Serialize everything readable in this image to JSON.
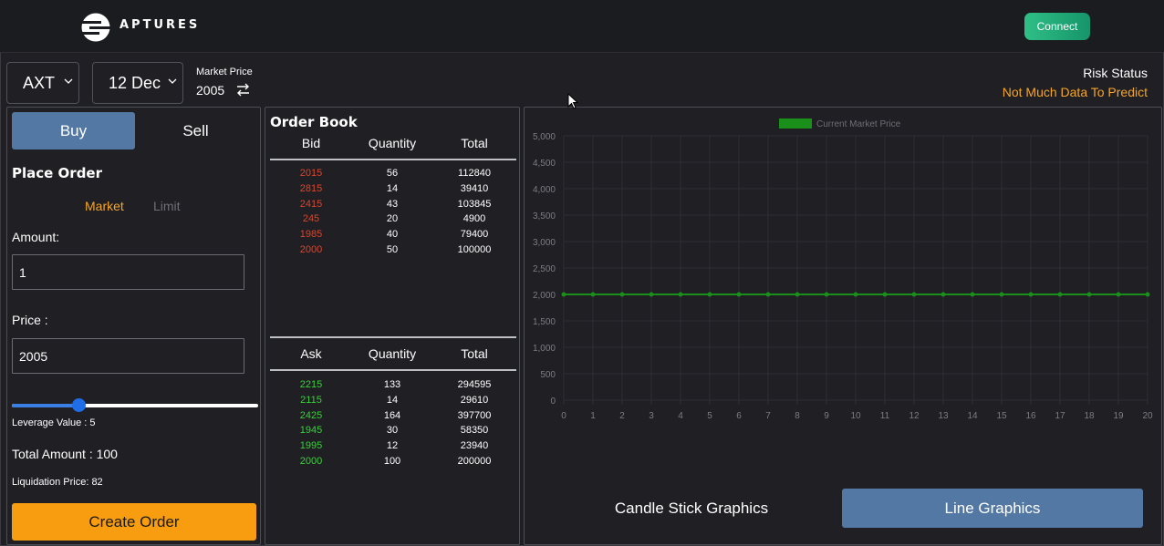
{
  "header": {
    "brand": "APTURES",
    "connect_label": "Connect",
    "logo_icon": "aptures-logo-icon"
  },
  "selectors": {
    "asset": "AXT",
    "date": "12 Dec"
  },
  "market": {
    "label": "Market Price",
    "value": "2005",
    "swap_icon": "swap-arrows-icon"
  },
  "risk": {
    "title": "Risk Status",
    "value": "Not Much Data To Predict",
    "value_color": "#f4a62a"
  },
  "order_form": {
    "buy_label": "Buy",
    "sell_label": "Sell",
    "place_order_title": "Place Order",
    "market_label": "Market",
    "limit_label": "Limit",
    "amount_label": "Amount:",
    "amount_value": "1",
    "price_label": "Price :",
    "price_value": "2005",
    "leverage_fraction": 0.27,
    "leverage_text": "Leverage Value : 5",
    "total_text": "Total Amount : 100",
    "liquidation_text": "Liquidation Price: 82",
    "create_label": "Create Order",
    "accent_color": "#f89c10",
    "buy_color": "#5278a3"
  },
  "order_book": {
    "title": "Order Book",
    "bid_headers": [
      "Bid",
      "Quantity",
      "Total"
    ],
    "bids": [
      [
        "2015",
        "56",
        "112840"
      ],
      [
        "2815",
        "14",
        "39410"
      ],
      [
        "2415",
        "43",
        "103845"
      ],
      [
        "245",
        "20",
        "4900"
      ],
      [
        "1985",
        "40",
        "79400"
      ],
      [
        "2000",
        "50",
        "100000"
      ]
    ],
    "ask_headers": [
      "Ask",
      "Quantity",
      "Total"
    ],
    "asks": [
      [
        "2215",
        "133",
        "294595"
      ],
      [
        "2115",
        "14",
        "29610"
      ],
      [
        "2425",
        "164",
        "397700"
      ],
      [
        "1945",
        "30",
        "58350"
      ],
      [
        "1995",
        "12",
        "23940"
      ],
      [
        "2000",
        "100",
        "200000"
      ]
    ],
    "bid_color": "#d8472e",
    "ask_color": "#3bcf3b"
  },
  "chart_data": {
    "type": "line",
    "title": "",
    "xlabel": "",
    "ylabel": "",
    "x": [
      0,
      1,
      2,
      3,
      4,
      5,
      6,
      7,
      8,
      9,
      10,
      11,
      12,
      13,
      14,
      15,
      16,
      17,
      18,
      19,
      20
    ],
    "series": [
      {
        "name": "Current Market Price",
        "color": "#1a8f1a",
        "values": [
          2000,
          2000,
          2000,
          2000,
          2000,
          2000,
          2000,
          2000,
          2000,
          2000,
          2000,
          2000,
          2000,
          2000,
          2000,
          2000,
          2000,
          2000,
          2000,
          2000,
          2000
        ]
      }
    ],
    "ylim": [
      0,
      5000
    ],
    "yticks": [
      "0",
      "500",
      "1,000",
      "1,500",
      "2,000",
      "2,500",
      "3,000",
      "3,500",
      "4,000",
      "4,500",
      "5,000"
    ],
    "xlim": [
      0,
      20
    ],
    "grid": true,
    "legend_position": "top-center"
  },
  "chart_buttons": {
    "candle_label": "Candle Stick Graphics",
    "line_label": "Line Graphics"
  }
}
